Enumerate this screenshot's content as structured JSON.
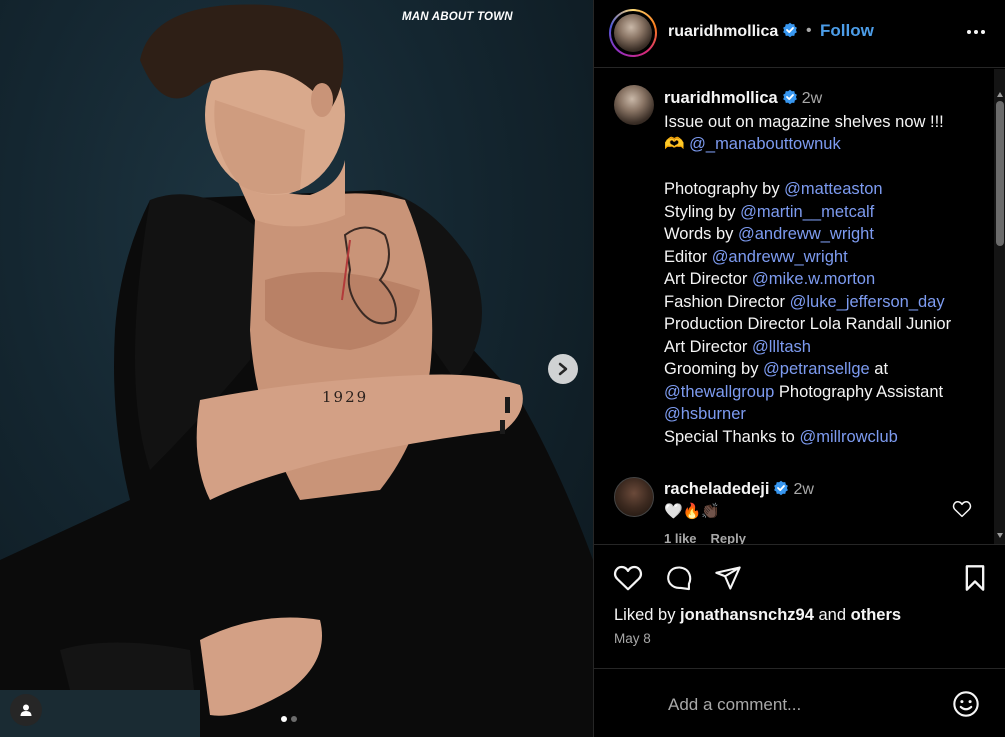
{
  "photo": {
    "magazine_mark": "MAN ABOUT TOWN",
    "tattoo_text": "1929",
    "carousel_count": 2,
    "carousel_active": 1
  },
  "header": {
    "username": "ruaridhmollica",
    "separator": "•",
    "follow_label": "Follow",
    "more_icon": "more-horizontal-icon"
  },
  "caption": {
    "username": "ruaridhmollica",
    "time": "2w",
    "lines": [
      {
        "plain": "Issue out on magazine shelves now !!!",
        "mention": "",
        "after": ""
      },
      {
        "plain": "🫶 ",
        "mention": "@_manabouttownuk",
        "after": ""
      },
      {
        "plain": "",
        "mention": "",
        "after": ""
      },
      {
        "plain": "Photography by ",
        "mention": "@matteaston",
        "after": ""
      },
      {
        "plain": "Styling by ",
        "mention": "@martin__metcalf",
        "after": ""
      },
      {
        "plain": "Words by ",
        "mention": "@andreww_wright",
        "after": ""
      },
      {
        "plain": "Editor ",
        "mention": "@andreww_wright",
        "after": ""
      },
      {
        "plain": "Art Director ",
        "mention": "@mike.w.morton",
        "after": ""
      },
      {
        "plain": "Fashion Director ",
        "mention": "@luke_jefferson_day",
        "after": ""
      },
      {
        "plain": "Production Director Lola Randall Junior",
        "mention": "",
        "after": ""
      },
      {
        "plain": "Art Director ",
        "mention": "@llltash",
        "after": ""
      },
      {
        "plain": "Grooming by ",
        "mention": "@petransellge",
        "after": " at"
      },
      {
        "plain": "",
        "mention": "@thewallgroup",
        "after": " Photography Assistant"
      },
      {
        "plain": "",
        "mention": "@hsburner",
        "after": ""
      },
      {
        "plain": "Special Thanks to ",
        "mention": "@millrowclub",
        "after": ""
      }
    ]
  },
  "comment": {
    "username": "racheladedeji",
    "time": "2w",
    "text": "🤍🔥👏🏿",
    "likes_label": "1 like",
    "reply_label": "Reply"
  },
  "actions": {
    "liked_by_prefix": "Liked by ",
    "liked_by_user": "jonathansnchz94",
    "liked_by_and": " and ",
    "liked_by_others": "others",
    "date": "May 8"
  },
  "add_comment": {
    "placeholder": "Add a comment..."
  },
  "colors": {
    "accent": "#4c9de8",
    "mention": "#7d9bf0",
    "verified": "#3897f0",
    "muted": "#a8a8a8"
  }
}
